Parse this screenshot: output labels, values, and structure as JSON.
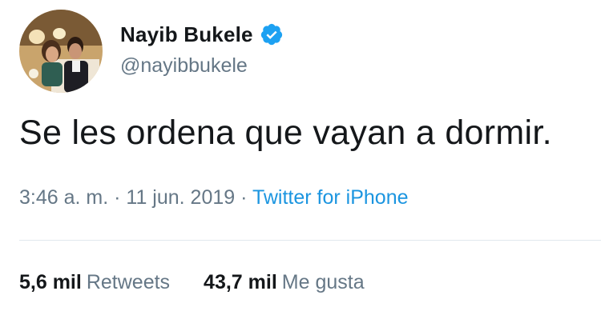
{
  "author": {
    "display_name": "Nayib Bukele",
    "handle": "@nayibbukele",
    "verified_icon": "verified-badge-icon",
    "avatar_icon": "profile-photo"
  },
  "tweet": {
    "text": "Se les ordena que vayan a dormir.",
    "time": "3:46 a. m.",
    "separator_1": "·",
    "date": "11 jun. 2019",
    "separator_2": "·",
    "source": "Twitter for iPhone"
  },
  "stats": {
    "retweets_count": "5,6 mil",
    "retweets_label": "Retweets",
    "likes_count": "43,7 mil",
    "likes_label": "Me gusta"
  },
  "colors": {
    "text": "#14171a",
    "secondary": "#657786",
    "link": "#1b95e0",
    "verified": "#1da1f2",
    "divider": "#e1e8ed"
  }
}
